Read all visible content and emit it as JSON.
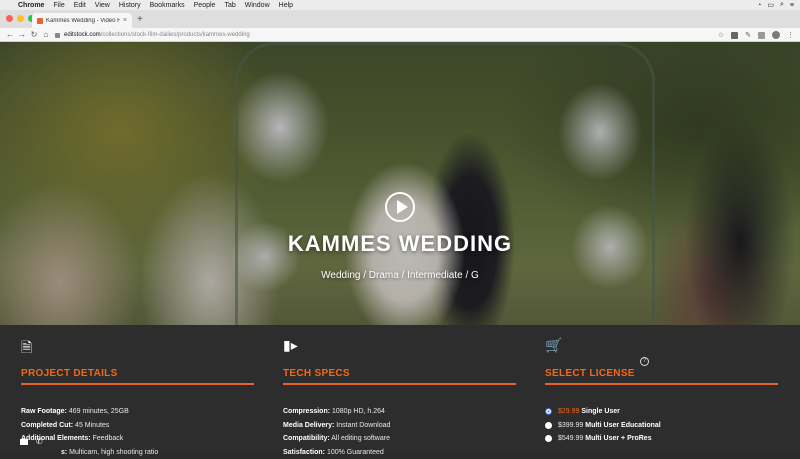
{
  "menubar": {
    "app": "Chrome",
    "items": [
      "File",
      "Edit",
      "View",
      "History",
      "Bookmarks",
      "People",
      "Tab",
      "Window",
      "Help"
    ],
    "icon_apple": "apple-icon"
  },
  "browser": {
    "tab_title": "Kammes Wedding - Video For E",
    "url_domain": "editstock.com",
    "url_path": "/collections/stock-film-dailies/products/kammes-wedding"
  },
  "hero": {
    "title": "KAMMES WEDDING",
    "subtitle": "Wedding / Drama / Intermediate / G"
  },
  "sections": {
    "project": {
      "heading": "PROJECT DETAILS",
      "icon": "file-icon",
      "rows": [
        {
          "label": "Raw Footage:",
          "value": " 469 minutes, 25GB"
        },
        {
          "label": "Completed Cut:",
          "value": " 45 Minutes"
        },
        {
          "label": "Additional Elements:",
          "value": " Feedback"
        },
        {
          "label": "s:",
          "value": " Multicam, high shooting ratio"
        }
      ]
    },
    "tech": {
      "heading": "TECH SPECS",
      "icon": "camera-icon",
      "rows": [
        {
          "label": "Compression:",
          "value": " 1080p HD, h.264"
        },
        {
          "label": "Media Delivery:",
          "value": " Instant Download"
        },
        {
          "label": "Compatibility:",
          "value": " All editing software"
        },
        {
          "label": "Satisfaction:",
          "value": " 100% Guaranteed"
        }
      ]
    },
    "license": {
      "heading": "SELECT LICENSE",
      "icon": "cart-icon",
      "help": "?",
      "options": [
        {
          "price": "$29.99",
          "name": " Single User",
          "selected": true
        },
        {
          "price": "$399.99",
          "name": " Multi User Educational",
          "selected": false
        },
        {
          "price": "$549.99",
          "name": " Multi User + ProRes",
          "selected": false
        }
      ]
    }
  },
  "colors": {
    "accent": "#e8632b",
    "background": "#2d2d2d",
    "radio_selected": "#2f6fd8"
  }
}
